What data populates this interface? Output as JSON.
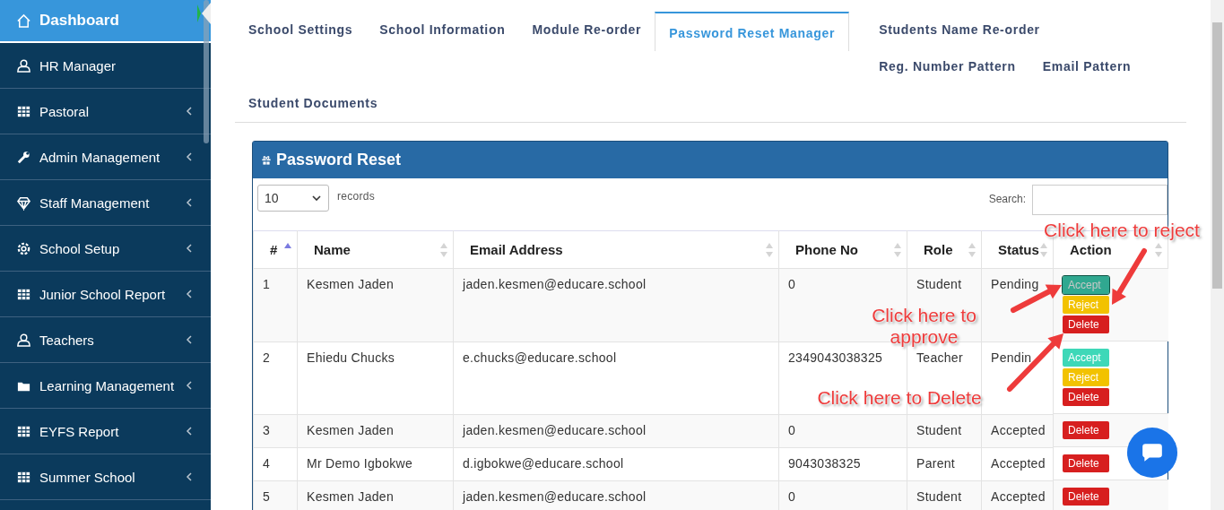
{
  "sidebar": {
    "items": [
      {
        "label": "Dashboard",
        "selected": true,
        "expandable": false
      },
      {
        "label": "HR Manager",
        "selected": false,
        "expandable": false
      },
      {
        "label": "Pastoral",
        "selected": false,
        "expandable": true
      },
      {
        "label": "Admin Management",
        "selected": false,
        "expandable": true
      },
      {
        "label": "Staff Management",
        "selected": false,
        "expandable": true
      },
      {
        "label": "School Setup",
        "selected": false,
        "expandable": true
      },
      {
        "label": "Junior School Report",
        "selected": false,
        "expandable": true
      },
      {
        "label": "Teachers",
        "selected": false,
        "expandable": true
      },
      {
        "label": "Learning Management",
        "selected": false,
        "expandable": true
      },
      {
        "label": "EYFS Report",
        "selected": false,
        "expandable": true
      },
      {
        "label": "Summer School",
        "selected": false,
        "expandable": true
      }
    ]
  },
  "tabs": [
    {
      "label": "School Settings",
      "selected": false
    },
    {
      "label": "School Information",
      "selected": false
    },
    {
      "label": "Module Re-order",
      "selected": false
    },
    {
      "label": "Password Reset Manager",
      "selected": true
    },
    {
      "label": "Students Name Re-order",
      "selected": false
    },
    {
      "label": "Reg. Number Pattern",
      "selected": false
    },
    {
      "label": "Email Pattern",
      "selected": false
    },
    {
      "label": "Student Documents",
      "selected": false
    }
  ],
  "panel": {
    "title": "Password Reset",
    "page_size": "10",
    "records_label": "records",
    "search_label": "Search:"
  },
  "table": {
    "columns": [
      {
        "label": "#",
        "sorted_ascending": true
      },
      {
        "label": "Name",
        "sorted_ascending": false
      },
      {
        "label": "Email Address",
        "sorted_ascending": false
      },
      {
        "label": "Phone No",
        "sorted_ascending": false
      },
      {
        "label": "Role",
        "sorted_ascending": false
      },
      {
        "label": "Status",
        "sorted_ascending": false
      },
      {
        "label": "Action",
        "sorted_ascending": false
      }
    ],
    "rows": [
      {
        "cells": [
          "1",
          "Kesmen Jaden",
          "jaden.kesmen@educare.school",
          "0",
          "Student",
          "Pending"
        ],
        "actions": [
          {
            "kind": "accept",
            "label": "Accept",
            "focused": true
          },
          {
            "kind": "reject",
            "label": "Reject",
            "focused": false
          },
          {
            "kind": "delete",
            "label": "Delete",
            "focused": false
          }
        ]
      },
      {
        "cells": [
          "2",
          "Ehiedu Chucks",
          "e.chucks@educare.school",
          "2349043038325",
          "Teacher",
          "Pendin"
        ],
        "actions": [
          {
            "kind": "accept",
            "label": "Accept",
            "focused": false
          },
          {
            "kind": "reject",
            "label": "Reject",
            "focused": false
          },
          {
            "kind": "delete",
            "label": "Delete",
            "focused": false
          }
        ]
      },
      {
        "cells": [
          "3",
          "Kesmen Jaden",
          "jaden.kesmen@educare.school",
          "0",
          "Student",
          "Accepted"
        ],
        "actions": [
          {
            "kind": "delete",
            "label": "Delete",
            "focused": false
          }
        ]
      },
      {
        "cells": [
          "4",
          "Mr Demo Igbokwe",
          "d.igbokwe@educare.school",
          "9043038325",
          "Parent",
          "Accepted"
        ],
        "actions": [
          {
            "kind": "delete",
            "label": "Delete",
            "focused": false
          }
        ]
      },
      {
        "cells": [
          "5",
          "Kesmen Jaden",
          "jaden.kesmen@educare.school",
          "0",
          "Student",
          "Accepted"
        ],
        "actions": [
          {
            "kind": "delete",
            "label": "Delete",
            "focused": false
          }
        ]
      }
    ]
  },
  "annotations": [
    {
      "text": "Click here to reject"
    },
    {
      "text": "Click here to approve"
    },
    {
      "text": "Click here to Delete"
    }
  ]
}
